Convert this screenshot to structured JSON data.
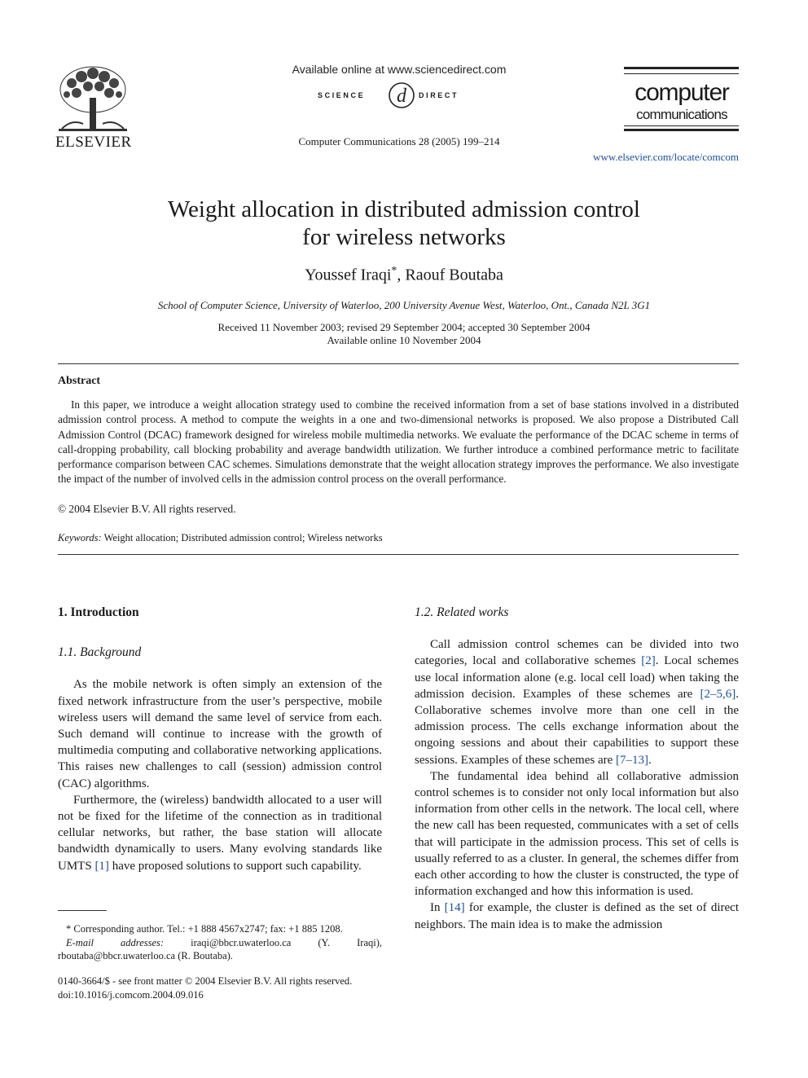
{
  "header": {
    "publisher": "ELSEVIER",
    "available_online": "Available online at www.sciencedirect.com",
    "sciencedirect_left": "SCIENCE",
    "sciencedirect_right": "DIRECT",
    "sciencedirect_mark": "®",
    "journal_ref": "Computer Communications 28 (2005) 199–214",
    "journal_logo_title": "computer",
    "journal_logo_sub": "communications",
    "journal_url": "www.elsevier.com/locate/comcom"
  },
  "article": {
    "title_line1": "Weight allocation in distributed admission control",
    "title_line2": "for wireless networks",
    "author1": "Youssef Iraqi",
    "author1_mark": "*",
    "author_sep": ", ",
    "author2": "Raouf Boutaba",
    "affiliation": "School of Computer Science, University of Waterloo, 200 University Avenue West, Waterloo, Ont., Canada N2L 3G1",
    "dates_line1": "Received 11 November 2003; revised 29 September 2004; accepted 30 September 2004",
    "dates_line2": "Available online 10 November 2004"
  },
  "abstract": {
    "heading": "Abstract",
    "body": "In this paper, we introduce a weight allocation strategy used to combine the received information from a set of base stations involved in a distributed admission control process. A method to compute the weights in a one and two-dimensional networks is proposed. We also propose a Distributed Call Admission Control (DCAC) framework designed for wireless mobile multimedia networks. We evaluate the performance of the DCAC scheme in terms of call-dropping probability, call blocking probability and average bandwidth utilization. We further introduce a combined performance metric to facilitate performance comparison between CAC schemes. Simulations demonstrate that the weight allocation strategy improves the performance. We also investigate the impact of the number of involved cells in the admission control process on the overall performance.",
    "copyright": "© 2004 Elsevier B.V. All rights reserved.",
    "keywords_label": "Keywords:",
    "keywords": "Weight allocation; Distributed admission control; Wireless networks"
  },
  "left_column": {
    "section_heading": "1. Introduction",
    "subsection_heading": "1.1. Background",
    "para1": "As the mobile network is often simply an extension of the fixed network infrastructure from the user’s perspective, mobile wireless users will demand the same level of service from each. Such demand will continue to increase with the growth of multimedia computing and collaborative networking applications. This raises new challenges to call (session) admission control (CAC) algorithms.",
    "para2_a": "Furthermore, the (wireless) bandwidth allocated to a user will not be fixed for the lifetime of the connection as in traditional cellular networks, but rather, the base station will allocate bandwidth dynamically to users. Many evolving standards like UMTS ",
    "para2_ref": "[1]",
    "para2_b": " have proposed solutions to support such capability."
  },
  "footnote": {
    "corresponding": "* Corresponding author. Tel.: +1 888 4567x2747; fax: +1 885 1208.",
    "email_label": "E-mail addresses:",
    "emails": " iraqi@bbcr.uwaterloo.ca (Y. Iraqi), rboutaba@bbcr.uwaterloo.ca (R. Boutaba).",
    "issn": "0140-3664/$ - see front matter © 2004 Elsevier B.V. All rights reserved.",
    "doi": "doi:10.1016/j.comcom.2004.09.016"
  },
  "right_column": {
    "subsection_heading": "1.2. Related works",
    "p1_a": "Call admission control schemes can be divided into two categories, local and collaborative schemes ",
    "p1_ref1": "[2]",
    "p1_b": ". Local schemes use local information alone (e.g. local cell load) when taking the admission decision. Examples of these schemes are ",
    "p1_ref2": "[2–5,6]",
    "p1_c": ". Collaborative schemes involve more than one cell in the admission process. The cells exchange information about the ongoing sessions and about their capabilities to support these sessions. Examples of these schemes are ",
    "p1_ref3": "[7–13]",
    "p1_d": ".",
    "p2": "The fundamental idea behind all collaborative admission control schemes is to consider not only local information but also information from other cells in the network. The local cell, where the new call has been requested, communicates with a set of cells that will participate in the admission process. This set of cells is usually referred to as a cluster. In general, the schemes differ from each other according to how the cluster is constructed, the type of information exchanged and how this information is used.",
    "p3_a": "In ",
    "p3_ref": "[14]",
    "p3_b": " for example, the cluster is defined as the set of direct neighbors. The main idea is to make the admission"
  },
  "colors": {
    "link": "#1a4fa0",
    "text": "#1a1a1a"
  }
}
